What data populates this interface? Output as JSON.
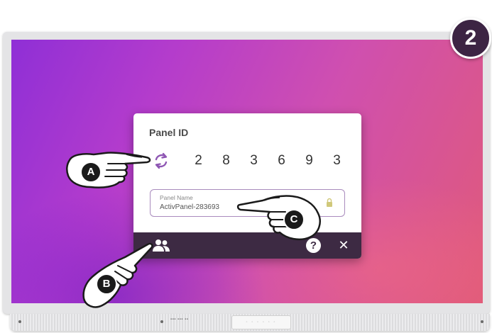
{
  "step_badge": "2",
  "dialog": {
    "title": "Panel ID",
    "panel_id_digits": [
      "2",
      "8",
      "3",
      "6",
      "9",
      "3"
    ],
    "name_field": {
      "label": "Panel Name",
      "value": "ActivPanel-283693"
    },
    "footer": {
      "help_symbol": "?",
      "close_symbol": "✕"
    }
  },
  "callouts": {
    "a": "A",
    "b": "B",
    "c": "C"
  },
  "colors": {
    "accent_purple": "#8e56b3",
    "footer_bg": "#3d2a43",
    "badge_bg": "#3c2443"
  },
  "icons": [
    "refresh-icon",
    "lock-icon",
    "users-icon",
    "help-icon",
    "close-icon",
    "pointing-hand-icon"
  ]
}
